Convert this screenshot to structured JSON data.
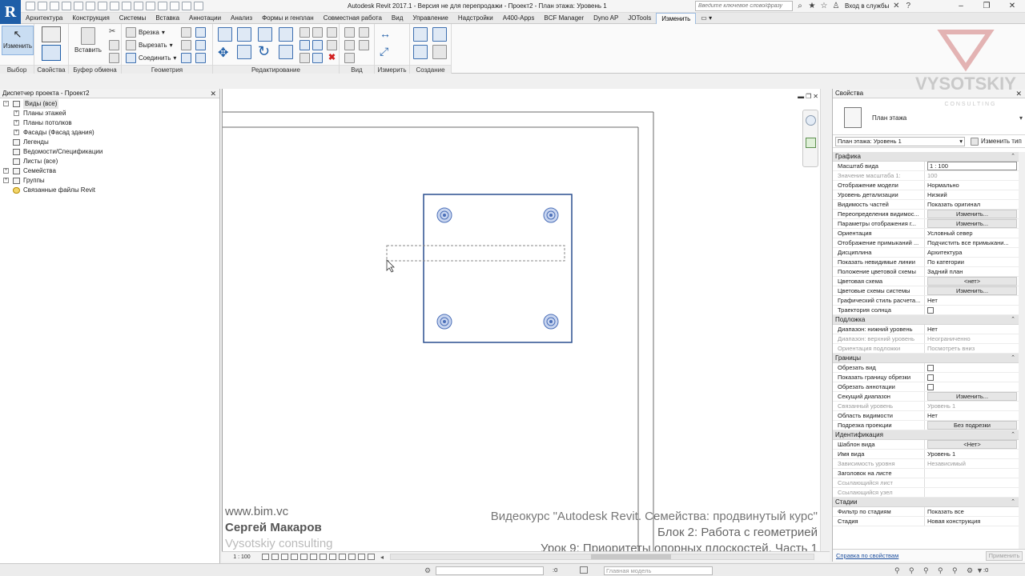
{
  "window": {
    "title": "Autodesk Revit 2017.1 - Версия не для перепродажи -    Проект2 - План этажа: Уровень 1",
    "search_placeholder": "Введите ключевое слово/фразу",
    "login": "Вход в службы",
    "app_letter": "R"
  },
  "ribbon": {
    "tabs": [
      "Архитектура",
      "Конструкция",
      "Системы",
      "Вставка",
      "Аннотации",
      "Анализ",
      "Формы и генплан",
      "Совместная работа",
      "Вид",
      "Управление",
      "Надстройки",
      "A400-Apps",
      "BCF Manager",
      "Dyno AP",
      "JOTools",
      "Изменить"
    ],
    "active_tab": "Изменить",
    "panels": {
      "select": {
        "title": "Выбор",
        "button": "Изменить"
      },
      "properties": {
        "title": "Свойства"
      },
      "clipboard": {
        "title": "Буфер обмена",
        "paste": "Вставить"
      },
      "geometry": {
        "title": "Геометрия",
        "cut": "Врезка",
        "cutout": "Вырезать",
        "join": "Соединить"
      },
      "modify": {
        "title": "Редактирование"
      },
      "view": {
        "title": "Вид"
      },
      "measure": {
        "title": "Измерить"
      },
      "create": {
        "title": "Создание"
      }
    }
  },
  "browser": {
    "title": "Диспетчер проекта - Проект2",
    "items": [
      {
        "label": "Виды (все)",
        "level": 0,
        "expander": "−"
      },
      {
        "label": "Планы этажей",
        "level": 1,
        "expander": "+"
      },
      {
        "label": "Планы потолков",
        "level": 1,
        "expander": "+"
      },
      {
        "label": "Фасады (Фасад здания)",
        "level": 1,
        "expander": "+"
      },
      {
        "label": "Легенды",
        "level": 0,
        "expander": ""
      },
      {
        "label": "Ведомости/Спецификации",
        "level": 0,
        "expander": ""
      },
      {
        "label": "Листы (все)",
        "level": 0,
        "expander": ""
      },
      {
        "label": "Семейства",
        "level": 0,
        "expander": "+"
      },
      {
        "label": "Группы",
        "level": 0,
        "expander": "+"
      },
      {
        "label": "Связанные файлы Revit",
        "level": 0,
        "expander": ""
      }
    ]
  },
  "canvas": {
    "scale": "1 : 100",
    "watermark": {
      "site": "www.bim.vc",
      "author": "Сергей Макаров",
      "company": "Vysotskiy consulting",
      "course": "Видеокурс \"Autodesk Revit. Семейства: продвинутый курс\"",
      "block": "Блок 2: Работа с геометрией",
      "lesson": "Урок 9: Приоритеты опорных плоскостей. Часть 1"
    }
  },
  "properties": {
    "title": "Свойства",
    "type_name": "План этажа",
    "instance": "План этажа: Уровень 1",
    "edit_type": "Изменить тип",
    "groups": [
      {
        "name": "Графика",
        "rows": [
          {
            "name": "Масштаб вида",
            "value": "1 : 100",
            "kind": "input"
          },
          {
            "name": "Значение масштаба    1:",
            "value": "100",
            "kind": "ro"
          },
          {
            "name": "Отображение модели",
            "value": "Нормально",
            "kind": "text"
          },
          {
            "name": "Уровень детализации",
            "value": "Низкий",
            "kind": "text"
          },
          {
            "name": "Видимость частей",
            "value": "Показать оригинал",
            "kind": "text"
          },
          {
            "name": "Переопределения видимос...",
            "value": "Изменить...",
            "kind": "button"
          },
          {
            "name": "Параметры отображения г...",
            "value": "Изменить...",
            "kind": "button"
          },
          {
            "name": "Ориентация",
            "value": "Условный север",
            "kind": "text"
          },
          {
            "name": "Отображение примыканий ...",
            "value": "Подчистить все примыкани...",
            "kind": "text"
          },
          {
            "name": "Дисциплина",
            "value": "Архитектура",
            "kind": "text"
          },
          {
            "name": "Показать невидимые линии",
            "value": "По категории",
            "kind": "text"
          },
          {
            "name": "Положение цветовой схемы",
            "value": "Задний план",
            "kind": "text"
          },
          {
            "name": "Цветовая схема",
            "value": "<нет>",
            "kind": "button"
          },
          {
            "name": "Цветовые схемы системы",
            "value": "Изменить...",
            "kind": "button"
          },
          {
            "name": "Графический стиль расчета...",
            "value": "Нет",
            "kind": "text"
          },
          {
            "name": "Траектория солнца",
            "value": "",
            "kind": "checkbox"
          }
        ]
      },
      {
        "name": "Подложка",
        "rows": [
          {
            "name": "Диапазон: нижний уровень",
            "value": "Нет",
            "kind": "text"
          },
          {
            "name": "Диапазон: верхний уровень",
            "value": "Неограниченно",
            "kind": "ro"
          },
          {
            "name": "Ориентация подложки",
            "value": "Посмотреть вниз",
            "kind": "ro"
          }
        ]
      },
      {
        "name": "Границы",
        "rows": [
          {
            "name": "Обрезать вид",
            "value": "",
            "kind": "checkbox"
          },
          {
            "name": "Показать границу обрезки",
            "value": "",
            "kind": "checkbox"
          },
          {
            "name": "Обрезать аннотации",
            "value": "",
            "kind": "checkbox"
          },
          {
            "name": "Секущий диапазон",
            "value": "Изменить...",
            "kind": "button"
          },
          {
            "name": "Связанный уровень",
            "value": "Уровень 1",
            "kind": "ro"
          },
          {
            "name": "Область видимости",
            "value": "Нет",
            "kind": "text"
          },
          {
            "name": "Подрезка проекции",
            "value": "Без подрезки",
            "kind": "button"
          }
        ]
      },
      {
        "name": "Идентификация",
        "rows": [
          {
            "name": "Шаблон вида",
            "value": "<Нет>",
            "kind": "button"
          },
          {
            "name": "Имя вида",
            "value": "Уровень 1",
            "kind": "text"
          },
          {
            "name": "Зависимость уровня",
            "value": "Независимый",
            "kind": "ro"
          },
          {
            "name": "Заголовок на листе",
            "value": "",
            "kind": "text"
          },
          {
            "name": "Ссылающийся лист",
            "value": "",
            "kind": "ro"
          },
          {
            "name": "Ссылающийся узел",
            "value": "",
            "kind": "ro"
          }
        ]
      },
      {
        "name": "Стадии",
        "rows": [
          {
            "name": "Фильтр по стадиям",
            "value": "Показать все",
            "kind": "text"
          },
          {
            "name": "Стадия",
            "value": "Новая конструкция",
            "kind": "text"
          }
        ]
      }
    ],
    "help_link": "Справка по свойствам",
    "apply": "Применить"
  },
  "statusbar": {
    "count": ":0",
    "model": "Главная модель",
    "filter": ":0"
  },
  "logo": {
    "text": "VYSOTSKIY",
    "sub": "C O N S U L T I N G"
  }
}
